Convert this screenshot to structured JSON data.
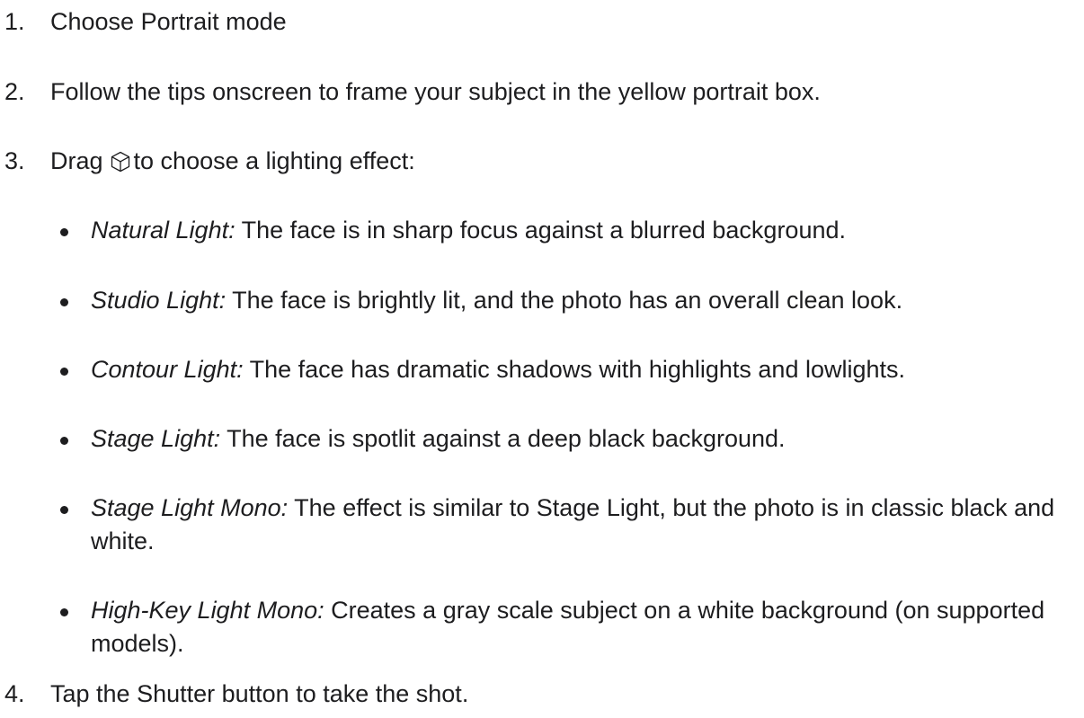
{
  "steps": [
    {
      "number": "1.",
      "text": "Choose Portrait mode"
    },
    {
      "number": "2.",
      "text": "Follow the tips onscreen to frame your subject in the yellow portrait box."
    },
    {
      "number": "3.",
      "text_before_icon": "Drag",
      "icon": "cube-icon",
      "text_after_icon": "to choose a lighting effect:"
    },
    {
      "number": "4.",
      "text": "Tap the Shutter button to take the shot."
    }
  ],
  "lighting_effects": [
    {
      "term": "Natural Light:",
      "description": " The face is in sharp focus against a blurred background."
    },
    {
      "term": "Studio Light:",
      "description": " The face is brightly lit, and the photo has an overall clean look."
    },
    {
      "term": "Contour Light:",
      "description": " The face has dramatic shadows with highlights and lowlights."
    },
    {
      "term": "Stage Light:",
      "description": " The face is spotlit against a deep black background."
    },
    {
      "term": "Stage Light Mono:",
      "description": " The effect is similar to Stage Light, but the photo is in classic black and white."
    },
    {
      "term": "High-Key Light Mono:",
      "description": " Creates a gray scale subject on a white background (on supported models)."
    }
  ],
  "colors": {
    "text": "#1d1d1f",
    "background": "#ffffff"
  }
}
